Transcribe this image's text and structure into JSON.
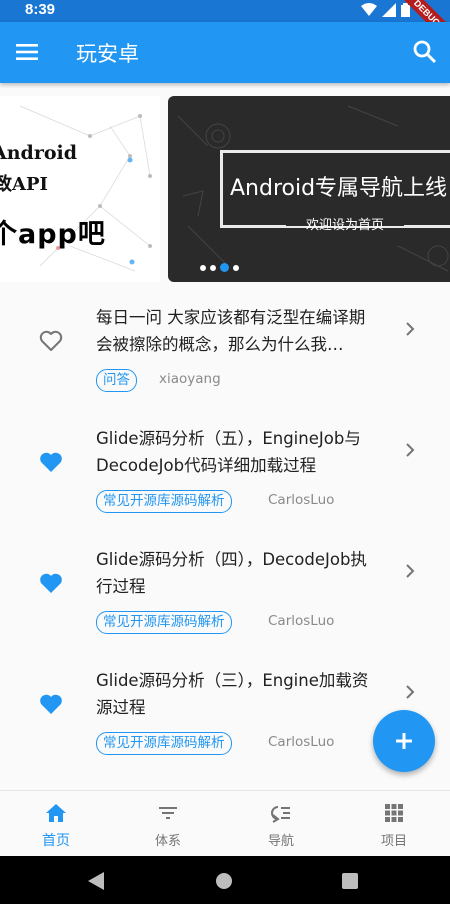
{
  "status_bar": {
    "time": "8:39",
    "debug_label": "DEBUG"
  },
  "app_bar": {
    "title": "玩安卓",
    "menu_icon": "menu-icon",
    "search_icon": "search-icon"
  },
  "banner": {
    "left_slide": {
      "line1": "Android",
      "line2": "致API",
      "line3": "个app吧"
    },
    "main_slide": {
      "headline": "Android专属导航上线",
      "subtitle": "欢迎设为首页"
    },
    "page_count": 4,
    "active_index": 2
  },
  "articles": [
    {
      "title": "每日一问 大家应该都有泛型在编译期会被擦除的概念，那么为什么我…",
      "tag": "问答",
      "author": "xiaoyang",
      "collected": false
    },
    {
      "title": "Glide源码分析（五），EngineJob与DecodeJob代码详细加载过程",
      "tag": "常见开源库源码解析",
      "author": "CarlosLuo",
      "collected": true
    },
    {
      "title": "Glide源码分析（四），DecodeJob执行过程",
      "tag": "常见开源库源码解析",
      "author": "CarlosLuo",
      "collected": true
    },
    {
      "title": "Glide源码分析（三），Engine加载资源过程",
      "tag": "常见开源库源码解析",
      "author": "CarlosLuo",
      "collected": true
    }
  ],
  "fab": {
    "icon": "plus-icon"
  },
  "bottom_nav": [
    {
      "label": "首页",
      "icon": "home-icon",
      "active": true
    },
    {
      "label": "体系",
      "icon": "filter-list-icon",
      "active": false
    },
    {
      "label": "导航",
      "icon": "format-list-icon",
      "active": false
    },
    {
      "label": "项目",
      "icon": "grid-icon",
      "active": false
    }
  ],
  "colors": {
    "primary": "#2196f3",
    "status_bar": "#1976d2",
    "background": "#fafafa"
  }
}
